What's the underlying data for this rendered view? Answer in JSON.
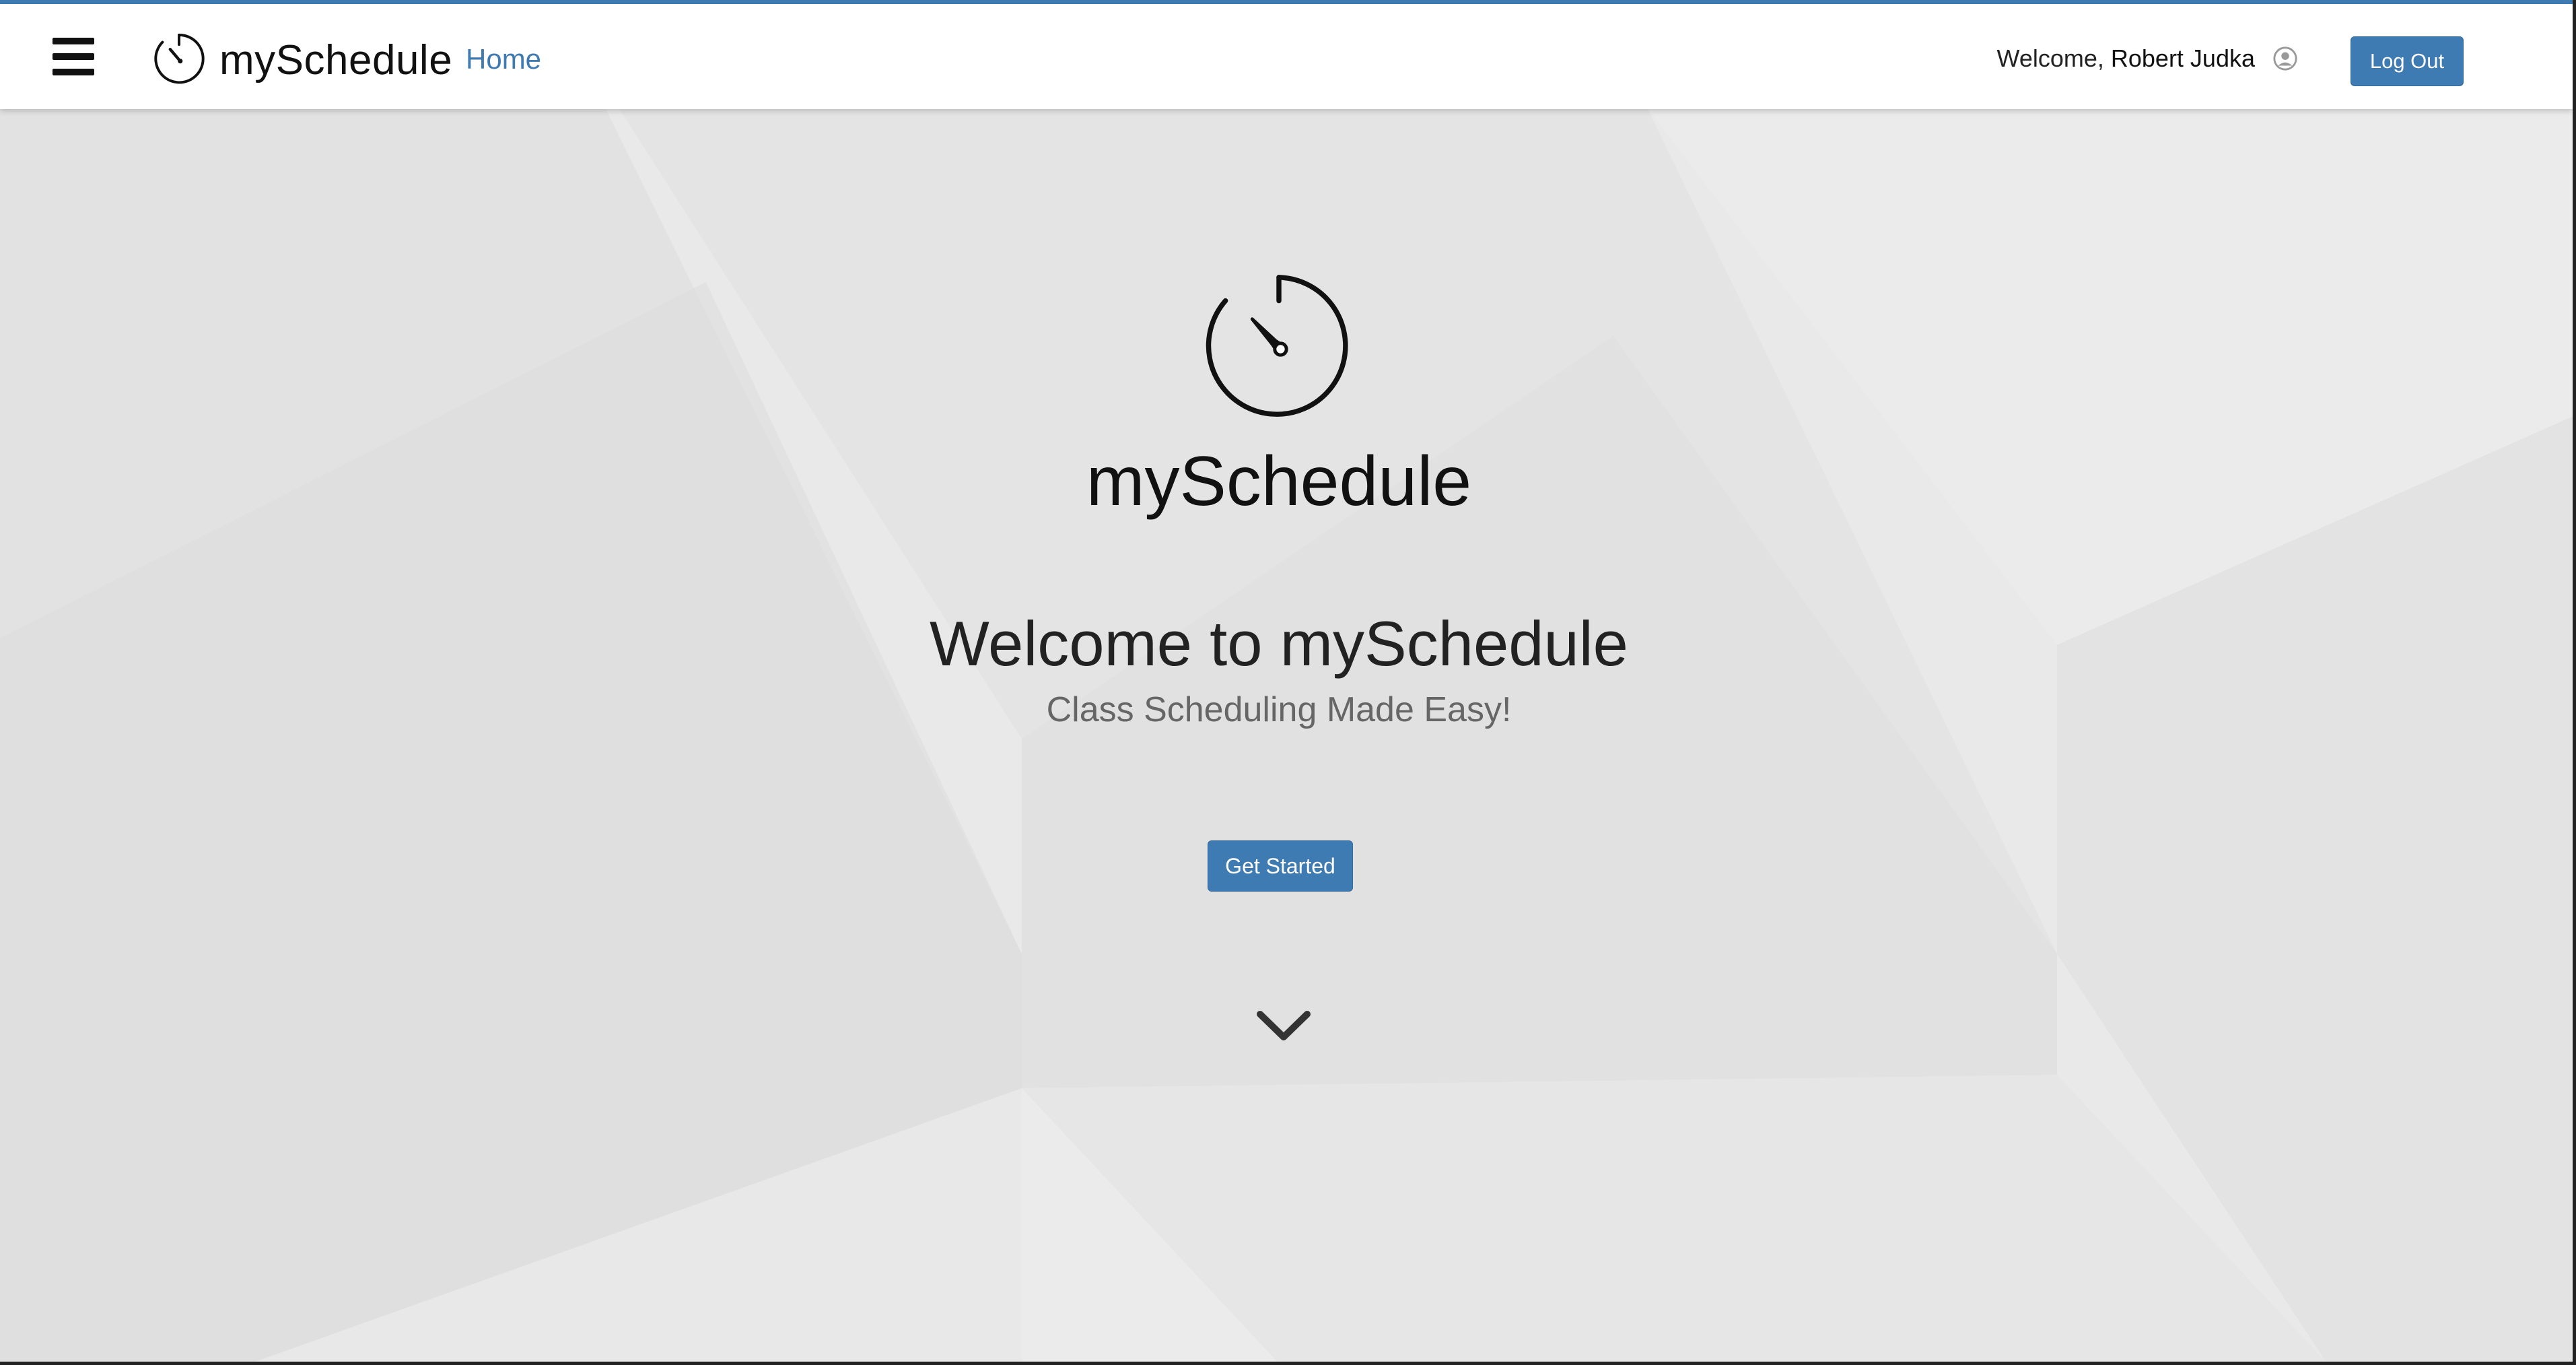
{
  "header": {
    "brand": "mySchedule",
    "nav_home": "Home",
    "welcome_prefix": "Welcome,",
    "user_name": "Robert Judka",
    "logout_label": "Log Out"
  },
  "hero": {
    "brand": "mySchedule",
    "title": "Welcome to mySchedule",
    "subtitle": "Class Scheduling Made Easy!",
    "cta_label": "Get Started"
  },
  "icons": {
    "menu": "hamburger-menu-icon",
    "logo": "stopwatch-logo-icon",
    "user": "user-avatar-icon",
    "scroll": "chevron-down-icon"
  },
  "colors": {
    "accent": "#3f7bb3",
    "background": "#e8e8e8",
    "header_bg": "#ffffff",
    "text_dark": "#111111"
  }
}
